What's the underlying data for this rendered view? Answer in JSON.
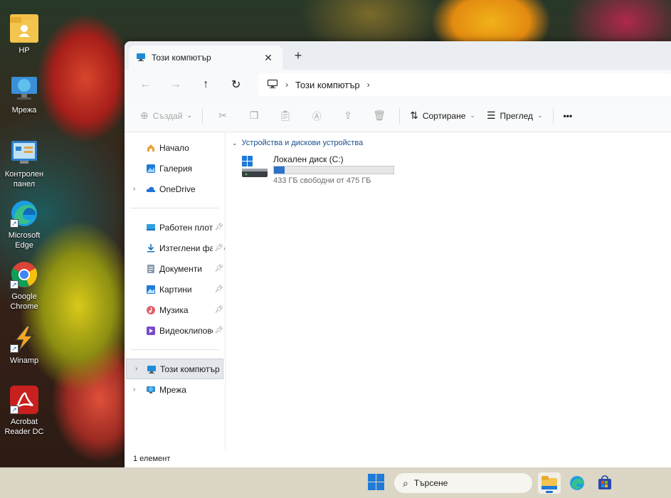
{
  "desktop": {
    "icons": [
      {
        "label": "HP",
        "icon": "user-folder-icon"
      },
      {
        "label": "Мрежа",
        "icon": "network-icon"
      },
      {
        "label": "Контролен панел",
        "icon": "control-panel-icon"
      },
      {
        "label": "Microsoft Edge",
        "icon": "edge-icon"
      },
      {
        "label": "Google Chrome",
        "icon": "chrome-icon"
      },
      {
        "label": "Winamp",
        "icon": "winamp-icon"
      },
      {
        "label": "Acrobat Reader DC",
        "icon": "acrobat-icon"
      }
    ]
  },
  "window": {
    "tab_title": "Този компютър",
    "tab_close": "✕",
    "new_tab": "+",
    "address": {
      "root_icon": "monitor-icon",
      "segments": [
        "Този компютър"
      ]
    },
    "toolbar": {
      "new_label": "Създай",
      "sort_label": "Сортиране",
      "view_label": "Преглед",
      "more_label": "•••"
    },
    "sidebar": {
      "top_items": [
        {
          "label": "Начало",
          "icon": "home-icon"
        },
        {
          "label": "Галерия",
          "icon": "gallery-icon"
        },
        {
          "label": "OneDrive",
          "icon": "cloud-icon"
        }
      ],
      "pinned_items": [
        {
          "label": "Работен плот",
          "icon": "desktop-icon"
        },
        {
          "label": "Изтеглени файлове",
          "icon": "download-icon"
        },
        {
          "label": "Документи",
          "icon": "documents-icon"
        },
        {
          "label": "Картини",
          "icon": "pictures-icon"
        },
        {
          "label": "Музика",
          "icon": "music-icon"
        },
        {
          "label": "Видеоклипове",
          "icon": "videos-icon"
        }
      ],
      "bottom_items": [
        {
          "label": "Този компютър",
          "icon": "monitor-icon",
          "selected": true
        },
        {
          "label": "Мрежа",
          "icon": "network-icon"
        }
      ]
    },
    "content": {
      "group_header": "Устройства и дискови устройства",
      "drive": {
        "name": "Локален диск (C:)",
        "used_fraction": 0.09,
        "free_text": "433 ГБ свободни от 475 ГБ"
      }
    },
    "status": "1 елемент"
  },
  "taskbar": {
    "search_placeholder": "Търсене",
    "apps": [
      "file-explorer-icon",
      "edge-icon",
      "store-icon"
    ]
  },
  "colors": {
    "accent": "#2b72c8",
    "group_header": "#1a4f8c",
    "taskbar_bg": "#e8e4d4"
  }
}
